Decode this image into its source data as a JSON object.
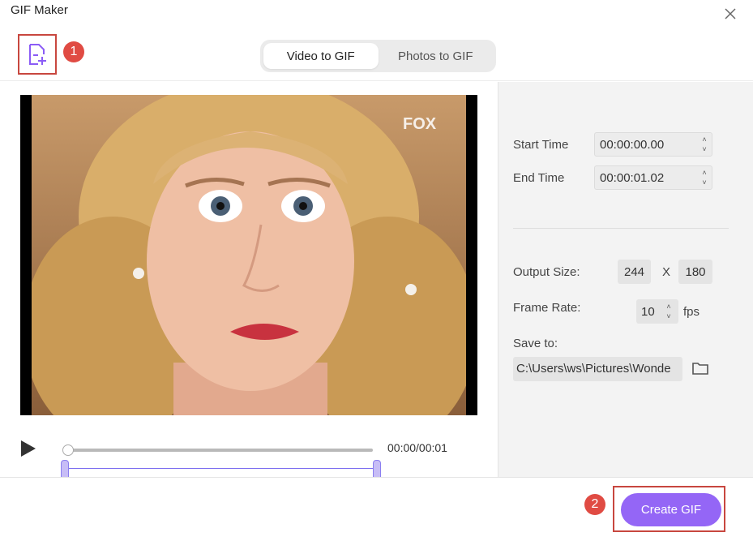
{
  "window": {
    "title": "GIF Maker"
  },
  "toolbar": {
    "step1_badge": "1",
    "tabs": [
      {
        "label": "Video to GIF",
        "active": true
      },
      {
        "label": "Photos to GIF",
        "active": false
      }
    ]
  },
  "video": {
    "watermark": "FOX",
    "time_display": "00:00/00:01",
    "playhead_position_fraction": 0.0
  },
  "settings": {
    "start_time_label": "Start Time",
    "start_time_value": "00:00:00.00",
    "end_time_label": "End Time",
    "end_time_value": "00:00:01.02",
    "output_size_label": "Output Size:",
    "output_width": "244",
    "size_separator": "X",
    "output_height": "180",
    "frame_rate_label": "Frame Rate:",
    "frame_rate_value": "10",
    "frame_rate_unit": "fps",
    "save_to_label": "Save to:",
    "save_path": "C:\\Users\\ws\\Pictures\\Wonde"
  },
  "footer": {
    "step2_badge": "2",
    "create_label": "Create GIF"
  },
  "colors": {
    "accent": "#9466f6",
    "highlight_box": "#c8473f",
    "badge": "#e04b43",
    "range_line": "#7a6cf0"
  },
  "icons": {
    "add_file": "add-file-icon",
    "close": "close-icon",
    "play": "play-icon",
    "folder": "folder-icon"
  }
}
